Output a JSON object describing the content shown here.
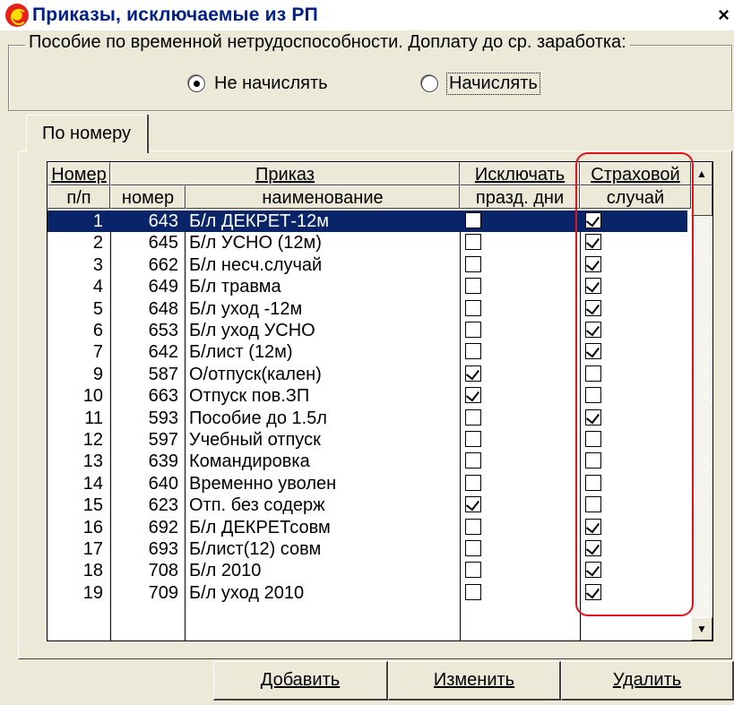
{
  "window": {
    "title": "Приказы, исключаемые из РП",
    "close": "×"
  },
  "group": {
    "legend": "Пособие по временной нетрудоспособности. Доплату до ср. заработка:",
    "options": [
      {
        "label": "Не начислять",
        "selected": true
      },
      {
        "label": "Начислять",
        "selected": false
      }
    ]
  },
  "tabs": [
    "По номеру"
  ],
  "grid": {
    "headers": {
      "num_top": "Номер",
      "num_bottom": "п/п",
      "order": "Приказ",
      "order_code": "номер",
      "order_name": "наименование",
      "exclude_top": "Исключать",
      "exclude_bottom": "празд. дни",
      "insured_top": "Страховой",
      "insured_bottom": "случай"
    },
    "rows": [
      {
        "n": "1",
        "code": "643",
        "name": "Б/л ДЕКРЕТ-12м",
        "exclude": false,
        "insured": true,
        "selected": true
      },
      {
        "n": "2",
        "code": "645",
        "name": "Б/л УСНО (12м)",
        "exclude": false,
        "insured": true
      },
      {
        "n": "3",
        "code": "662",
        "name": "Б/л несч.случай",
        "exclude": false,
        "insured": true
      },
      {
        "n": "4",
        "code": "649",
        "name": "Б/л травма",
        "exclude": false,
        "insured": true
      },
      {
        "n": "5",
        "code": "648",
        "name": "Б/л уход -12м",
        "exclude": false,
        "insured": true
      },
      {
        "n": "6",
        "code": "653",
        "name": "Б/л уход УСНО",
        "exclude": false,
        "insured": true
      },
      {
        "n": "7",
        "code": "642",
        "name": "Б/лист (12м)",
        "exclude": false,
        "insured": true
      },
      {
        "n": "9",
        "code": "587",
        "name": "О/отпуск(кален)",
        "exclude": true,
        "insured": false
      },
      {
        "n": "10",
        "code": "663",
        "name": "Отпуск пов.ЗП",
        "exclude": true,
        "insured": false
      },
      {
        "n": "11",
        "code": "593",
        "name": "Пособие до 1.5л",
        "exclude": false,
        "insured": true
      },
      {
        "n": "12",
        "code": "597",
        "name": "Учебный отпуск",
        "exclude": false,
        "insured": false
      },
      {
        "n": "13",
        "code": "639",
        "name": "Командировка",
        "exclude": false,
        "insured": false
      },
      {
        "n": "14",
        "code": "640",
        "name": "Временно уволен",
        "exclude": false,
        "insured": false
      },
      {
        "n": "15",
        "code": "623",
        "name": "Отп. без содерж",
        "exclude": true,
        "insured": false
      },
      {
        "n": "16",
        "code": "692",
        "name": "Б/л ДЕКРЕТсовм",
        "exclude": false,
        "insured": true
      },
      {
        "n": "17",
        "code": "693",
        "name": "Б/лист(12) совм",
        "exclude": false,
        "insured": true
      },
      {
        "n": "18",
        "code": "708",
        "name": "Б/л 2010",
        "exclude": false,
        "insured": true
      },
      {
        "n": "19",
        "code": "709",
        "name": "Б/л уход 2010",
        "exclude": false,
        "insured": true
      }
    ]
  },
  "buttons": {
    "add": "Добавить",
    "edit": "Изменить",
    "delete": "Удалить"
  },
  "colors": {
    "highlight": "#e0141e",
    "selection": "#0a246a",
    "face": "#ece9d8"
  }
}
